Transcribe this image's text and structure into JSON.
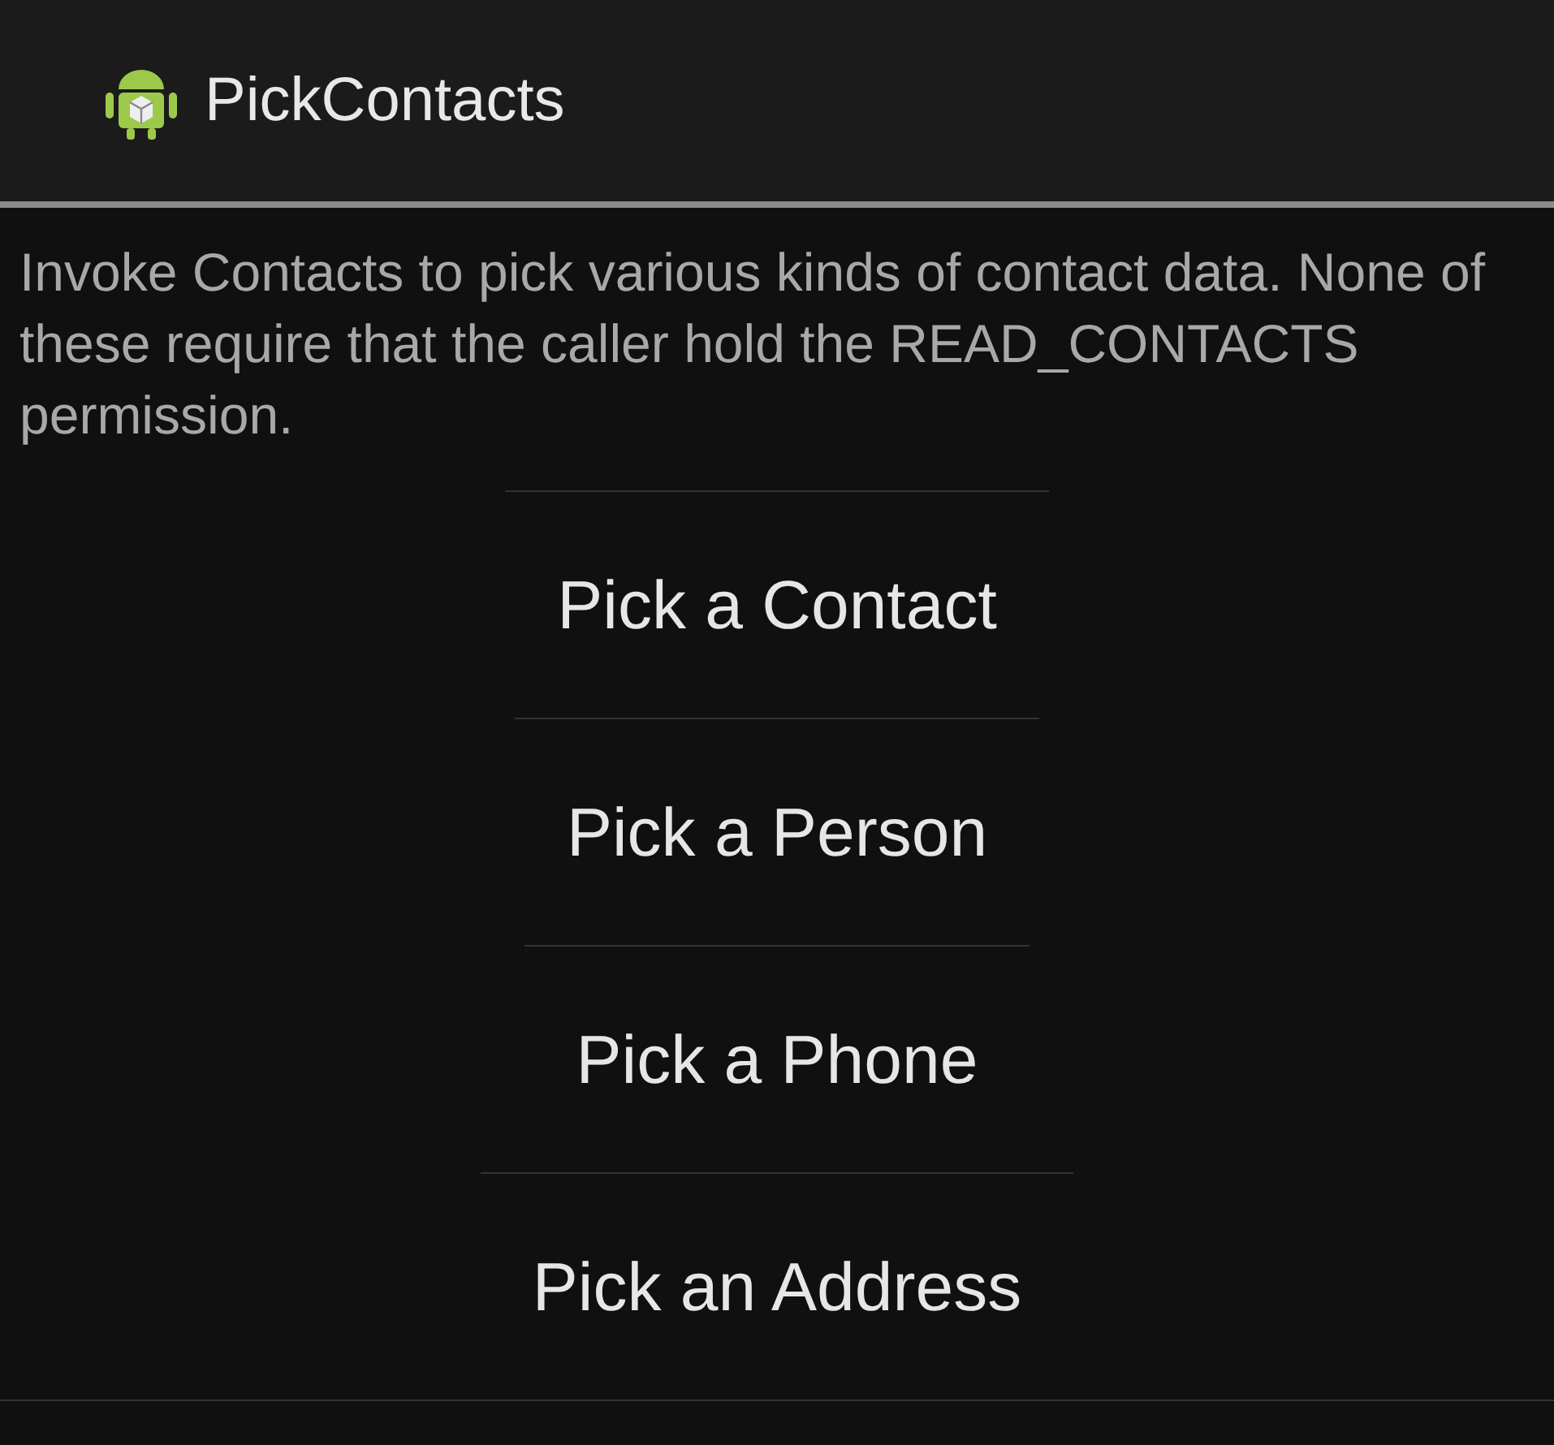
{
  "action_bar": {
    "title": "PickContacts"
  },
  "description": "Invoke Contacts to pick various kinds of contact data. None of these require that the caller hold the READ_CONTACTS permission.",
  "buttons": [
    {
      "label": "Pick a Contact"
    },
    {
      "label": "Pick a Person"
    },
    {
      "label": "Pick a Phone"
    },
    {
      "label": "Pick an Address"
    }
  ]
}
